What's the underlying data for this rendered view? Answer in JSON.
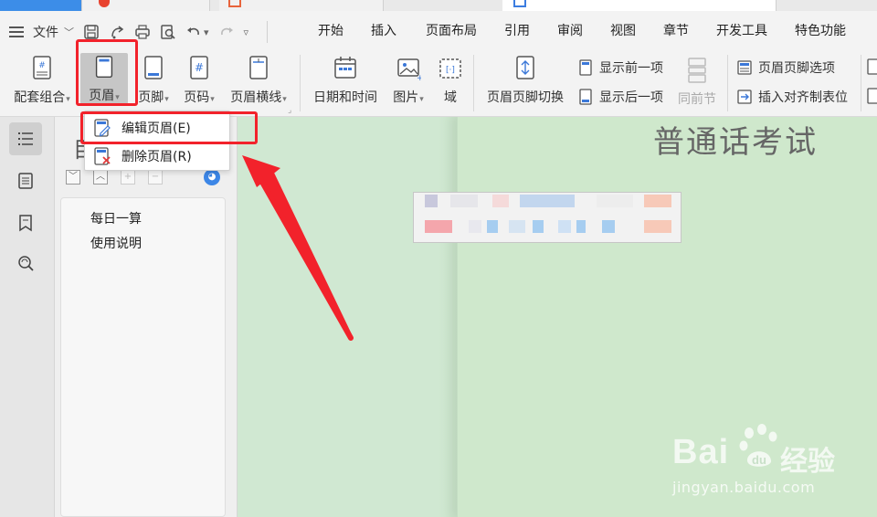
{
  "menubar": {
    "file_label": "文件",
    "tabs": [
      "开始",
      "插入",
      "页面布局",
      "引用",
      "审阅",
      "视图",
      "章节",
      "开发工具",
      "特色功能"
    ]
  },
  "ribbon": {
    "group1": [
      {
        "label": "配套组合",
        "has_caret": true,
        "icon": "bundle-icon"
      },
      {
        "label": "页眉",
        "has_caret": true,
        "icon": "header-icon"
      },
      {
        "label": "页脚",
        "has_caret": true,
        "icon": "footer-icon"
      },
      {
        "label": "页码",
        "has_caret": true,
        "icon": "page-number-icon"
      },
      {
        "label": "页眉横线",
        "has_caret": true,
        "icon": "header-line-icon"
      }
    ],
    "group2": [
      {
        "label": "日期和时间",
        "icon": "calendar-icon"
      },
      {
        "label": "图片",
        "has_caret": true,
        "icon": "image-icon"
      },
      {
        "label": "域",
        "icon": "field-icon"
      }
    ],
    "switch_label": "页眉页脚切换",
    "prev_label": "显示前一项",
    "next_label": "显示后一项",
    "same_section_label": "同前节",
    "options_label": "页眉页脚选项",
    "insert_tab_label": "插入对齐制表位"
  },
  "dropdown": {
    "items": [
      {
        "label": "编辑页眉(E)",
        "icon": "edit-header-icon"
      },
      {
        "label": "删除页眉(R)",
        "icon": "delete-header-icon"
      }
    ]
  },
  "navpane": {
    "title_ghost": "目",
    "items": [
      "每日一算",
      "使用说明"
    ]
  },
  "document": {
    "title": "普通话考试"
  },
  "watermark": {
    "brand": "Bai",
    "brand2": "du",
    "jingyan": "经验",
    "url": "jingyan.baidu.com"
  },
  "colors": {
    "highlight": "#f2222b",
    "doc_bg": "#cfe8cc",
    "accent_blue": "#3c86e6"
  }
}
